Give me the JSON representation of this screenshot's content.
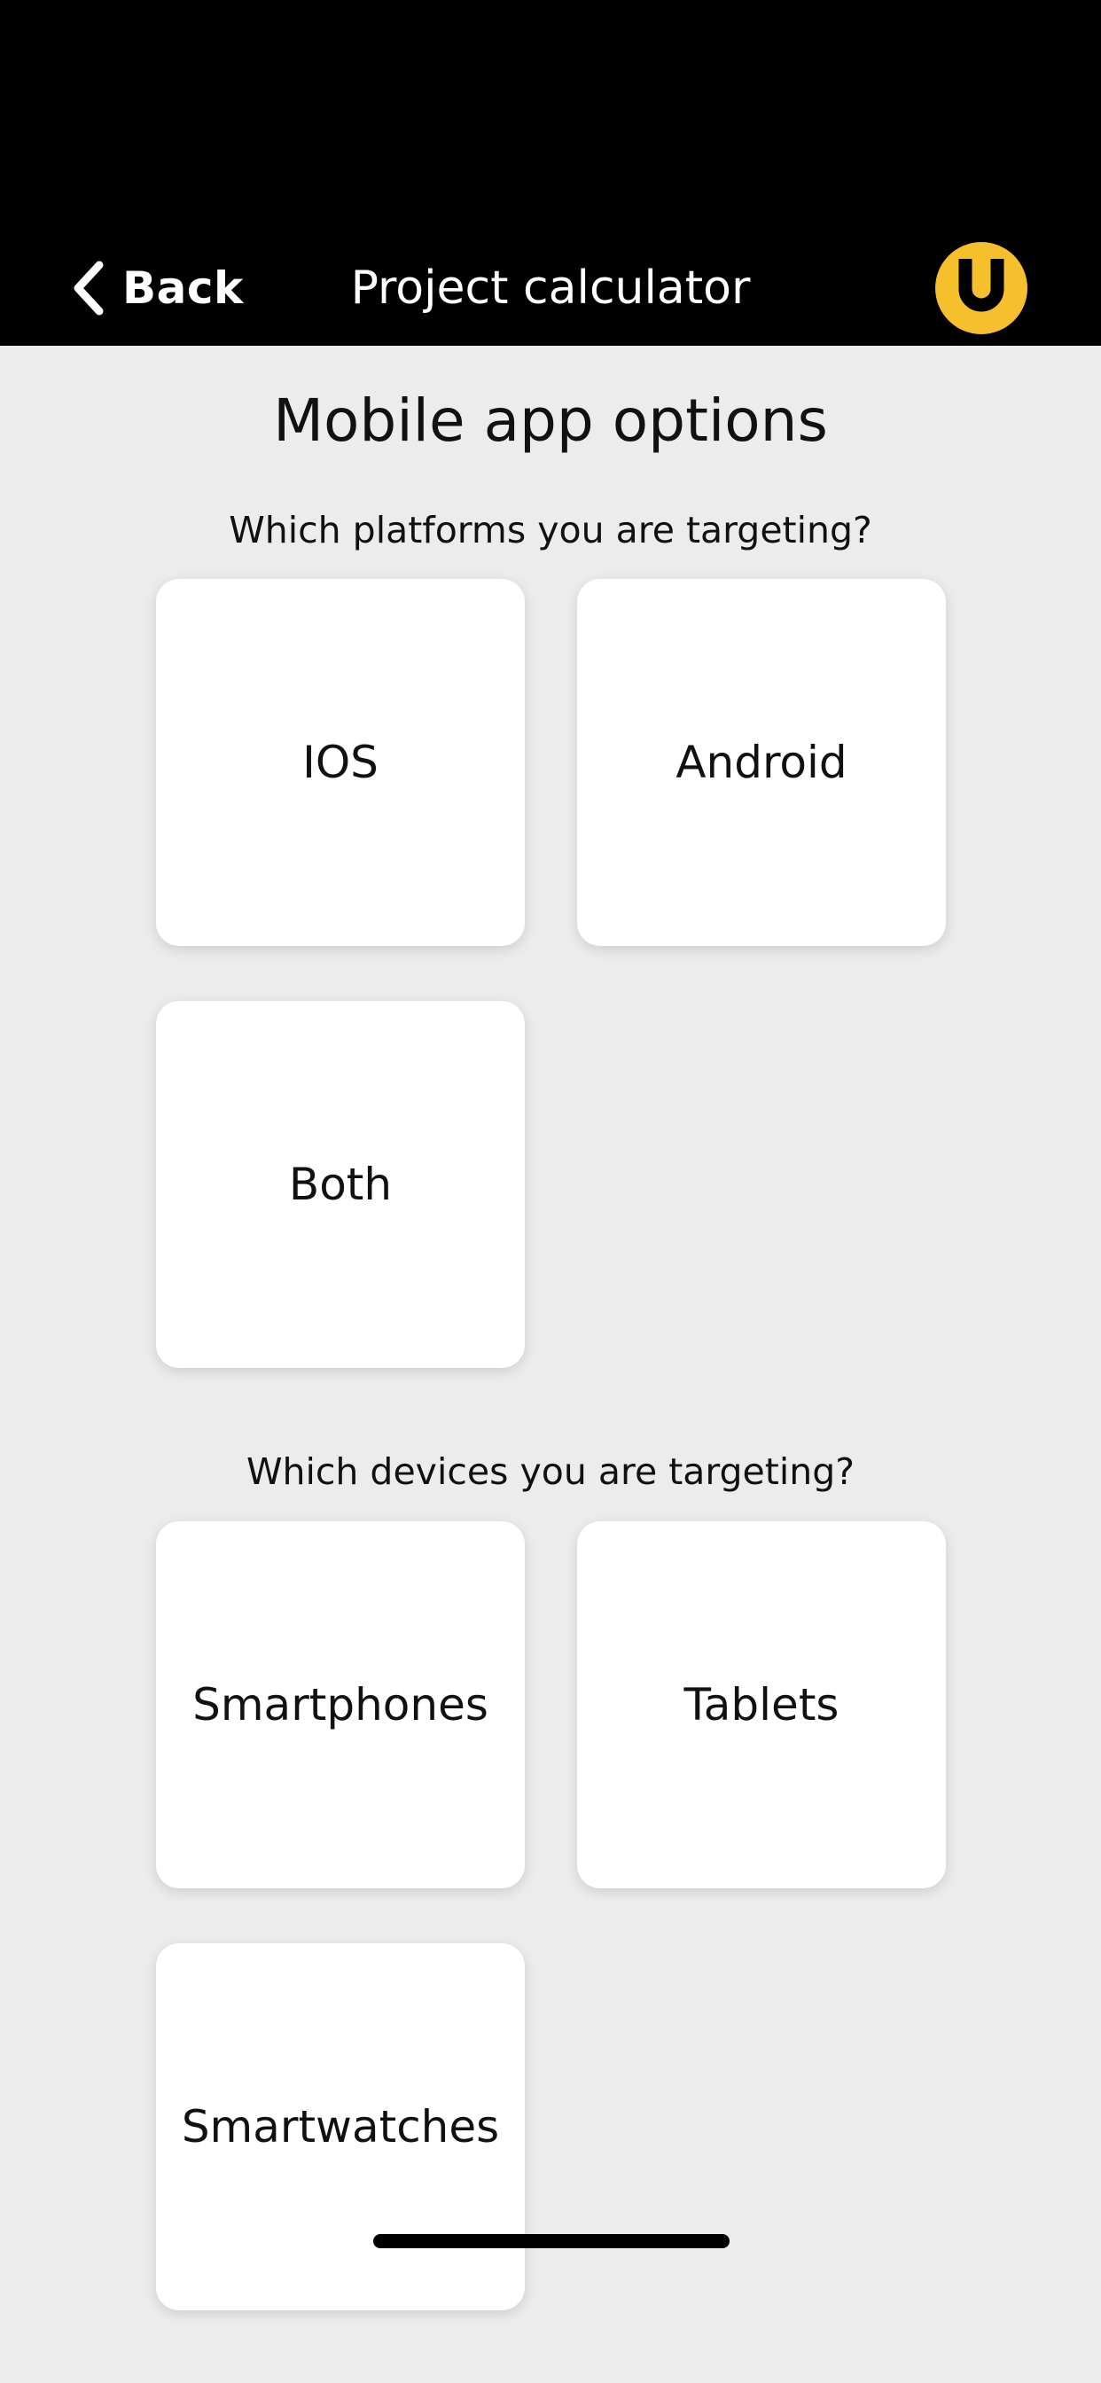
{
  "nav": {
    "back_label": "Back",
    "title": "Project calculator",
    "logo_color": "#f5c02c"
  },
  "page": {
    "title": "Mobile app options"
  },
  "platforms": {
    "question": "Which platforms you are targeting?",
    "options": [
      "IOS",
      "Android",
      "Both"
    ]
  },
  "devices": {
    "question": "Which devices you are targeting?",
    "options": [
      "Smartphones",
      "Tablets",
      "Smartwatches"
    ]
  }
}
